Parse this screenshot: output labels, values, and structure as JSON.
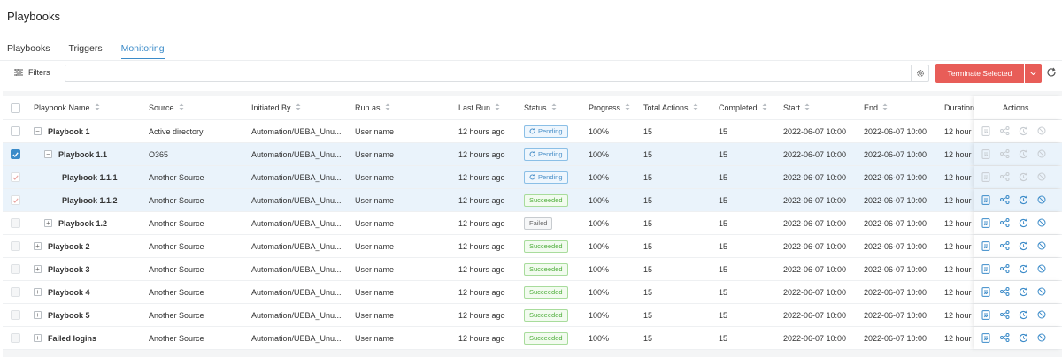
{
  "page": {
    "title": "Playbooks"
  },
  "tabs": [
    {
      "label": "Playbooks"
    },
    {
      "label": "Triggers"
    },
    {
      "label": "Monitoring"
    }
  ],
  "toolbar": {
    "filters_label": "Filters",
    "search_value": "",
    "terminate_label": "Terminate Selected"
  },
  "table": {
    "columns": {
      "name": "Playbook Name",
      "source": "Source",
      "initiated_by": "Initiated By",
      "run_as": "Run as",
      "last_run": "Last Run",
      "status": "Status",
      "progress": "Progress",
      "total_actions": "Total Actions",
      "completed": "Completed",
      "start": "Start",
      "end": "End",
      "duration": "Duration",
      "actions": "Actions"
    },
    "rows": [
      {
        "name": "Playbook 1",
        "indent": 0,
        "toggle": "−",
        "check": "empty",
        "source": "Active directory",
        "initiated_by": "Automation/UEBA_Unu...",
        "run_as": "User name",
        "last_run": "12 hours ago",
        "status": "Pending",
        "status_type": "pending",
        "progress": "100%",
        "total_actions": "15",
        "completed": "15",
        "start": "2022-06-07 10:00",
        "end": "2022-06-07 10:00",
        "duration": "12 hour",
        "actions_enabled": false,
        "selected": false
      },
      {
        "name": "Playbook 1.1",
        "indent": 1,
        "toggle": "−",
        "check": "checked",
        "source": "O365",
        "initiated_by": "Automation/UEBA_Unu...",
        "run_as": "User name",
        "last_run": "12 hours ago",
        "status": "Pending",
        "status_type": "pending",
        "progress": "100%",
        "total_actions": "15",
        "completed": "15",
        "start": "2022-06-07 10:00",
        "end": "2022-06-07 10:00",
        "duration": "12 hour",
        "actions_enabled": false,
        "selected": true
      },
      {
        "name": "Playbook 1.1.1",
        "indent": 2,
        "toggle": "",
        "check": "checked-light",
        "source": "Another Source",
        "initiated_by": "Automation/UEBA_Unu...",
        "run_as": "User name",
        "last_run": "12 hours ago",
        "status": "Pending",
        "status_type": "pending",
        "progress": "100%",
        "total_actions": "15",
        "completed": "15",
        "start": "2022-06-07 10:00",
        "end": "2022-06-07 10:00",
        "duration": "12 hour",
        "actions_enabled": false,
        "selected": true
      },
      {
        "name": "Playbook 1.1.2",
        "indent": 2,
        "toggle": "",
        "check": "checked-light",
        "source": "Another Source",
        "initiated_by": "Automation/UEBA_Unu...",
        "run_as": "User name",
        "last_run": "12 hours ago",
        "status": "Succeeded",
        "status_type": "succeeded",
        "progress": "100%",
        "total_actions": "15",
        "completed": "15",
        "start": "2022-06-07 10:00",
        "end": "2022-06-07 10:00",
        "duration": "12 hour",
        "actions_enabled": true,
        "selected": true
      },
      {
        "name": "Playbook 1.2",
        "indent": 1,
        "toggle": "+",
        "check": "disabled",
        "source": "Another Source",
        "initiated_by": "Automation/UEBA_Unu...",
        "run_as": "User name",
        "last_run": "12 hours ago",
        "status": "Failed",
        "status_type": "failed",
        "progress": "100%",
        "total_actions": "15",
        "completed": "15",
        "start": "2022-06-07 10:00",
        "end": "2022-06-07 10:00",
        "duration": "12 hour",
        "actions_enabled": true,
        "selected": false
      },
      {
        "name": "Playbook 2",
        "indent": 0,
        "toggle": "+",
        "check": "disabled",
        "source": "Another Source",
        "initiated_by": "Automation/UEBA_Unu...",
        "run_as": "User name",
        "last_run": "12 hours ago",
        "status": "Succeeded",
        "status_type": "succeeded",
        "progress": "100%",
        "total_actions": "15",
        "completed": "15",
        "start": "2022-06-07 10:00",
        "end": "2022-06-07 10:00",
        "duration": "12 hour",
        "actions_enabled": true,
        "selected": false
      },
      {
        "name": "Playbook 3",
        "indent": 0,
        "toggle": "+",
        "check": "disabled",
        "source": "Another Source",
        "initiated_by": "Automation/UEBA_Unu...",
        "run_as": "User name",
        "last_run": "12 hours ago",
        "status": "Succeeded",
        "status_type": "succeeded",
        "progress": "100%",
        "total_actions": "15",
        "completed": "15",
        "start": "2022-06-07 10:00",
        "end": "2022-06-07 10:00",
        "duration": "12 hour",
        "actions_enabled": true,
        "selected": false
      },
      {
        "name": "Playbook 4",
        "indent": 0,
        "toggle": "+",
        "check": "disabled",
        "source": "Another Source",
        "initiated_by": "Automation/UEBA_Unu...",
        "run_as": "User name",
        "last_run": "12 hours ago",
        "status": "Succeeded",
        "status_type": "succeeded",
        "progress": "100%",
        "total_actions": "15",
        "completed": "15",
        "start": "2022-06-07 10:00",
        "end": "2022-06-07 10:00",
        "duration": "12 hour",
        "actions_enabled": true,
        "selected": false
      },
      {
        "name": "Playbook 5",
        "indent": 0,
        "toggle": "+",
        "check": "disabled",
        "source": "Another Source",
        "initiated_by": "Automation/UEBA_Unu...",
        "run_as": "User name",
        "last_run": "12 hours ago",
        "status": "Succeeded",
        "status_type": "succeeded",
        "progress": "100%",
        "total_actions": "15",
        "completed": "15",
        "start": "2022-06-07 10:00",
        "end": "2022-06-07 10:00",
        "duration": "12 hour",
        "actions_enabled": true,
        "selected": false
      },
      {
        "name": "Failed logins",
        "indent": 0,
        "toggle": "+",
        "check": "disabled",
        "source": "Another Source",
        "initiated_by": "Automation/UEBA_Unu...",
        "run_as": "User name",
        "last_run": "12 hours ago",
        "status": "Succeeded",
        "status_type": "succeeded",
        "progress": "100%",
        "total_actions": "15",
        "completed": "15",
        "start": "2022-06-07 10:00",
        "end": "2022-06-07 10:00",
        "duration": "12 hour",
        "actions_enabled": true,
        "selected": false
      }
    ]
  },
  "colors": {
    "accent": "#3b8bc9",
    "danger": "#e85d58",
    "selected_row": "#eaf3fb",
    "action_enabled": "#3b8bc9",
    "action_disabled": "#c7ccd1"
  },
  "icons": {
    "filters": "filter-lines-icon",
    "settings": "gear-icon",
    "caret": "chevron-down-icon",
    "refresh": "refresh-icon",
    "sort": "sort-icon",
    "actions": [
      "report-icon",
      "workflow-icon",
      "history-icon",
      "stop-icon"
    ]
  }
}
